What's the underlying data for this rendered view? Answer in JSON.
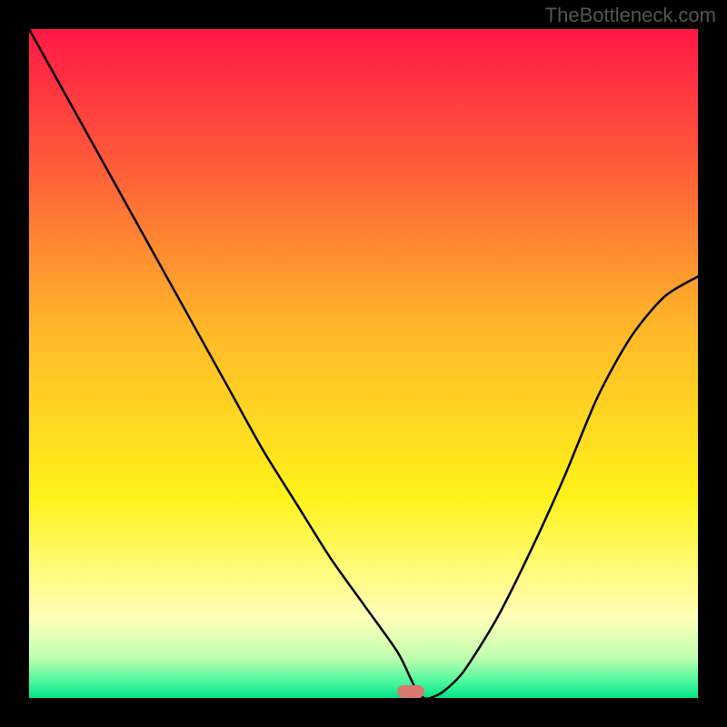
{
  "attribution": "TheBottleneck.com",
  "chart_data": {
    "type": "line",
    "title": "",
    "xlabel": "",
    "ylabel": "",
    "xlim": [
      0,
      100
    ],
    "ylim": [
      0,
      100
    ],
    "x": [
      0,
      5,
      10,
      15,
      20,
      25,
      30,
      35,
      40,
      45,
      50,
      55,
      57,
      58,
      59,
      60,
      62,
      65,
      70,
      75,
      80,
      85,
      90,
      95,
      100
    ],
    "y": [
      100,
      91,
      82,
      73,
      64,
      55,
      46,
      37,
      29,
      21,
      14,
      7,
      3,
      1,
      0,
      0,
      1,
      4,
      12,
      22,
      33,
      45,
      54,
      60,
      63
    ],
    "minimum_x": 59,
    "marker": {
      "x": 57,
      "color": "#d8786f"
    },
    "background_gradient": {
      "stops": [
        {
          "offset": 0.0,
          "color": "#ff1846"
        },
        {
          "offset": 0.2,
          "color": "#ff5a3a"
        },
        {
          "offset": 0.45,
          "color": "#ffb829"
        },
        {
          "offset": 0.7,
          "color": "#fff21a"
        },
        {
          "offset": 0.88,
          "color": "#ffffb8"
        },
        {
          "offset": 0.94,
          "color": "#c0ffb0"
        },
        {
          "offset": 0.98,
          "color": "#3ff59a"
        },
        {
          "offset": 1.0,
          "color": "#05e285"
        }
      ]
    }
  }
}
